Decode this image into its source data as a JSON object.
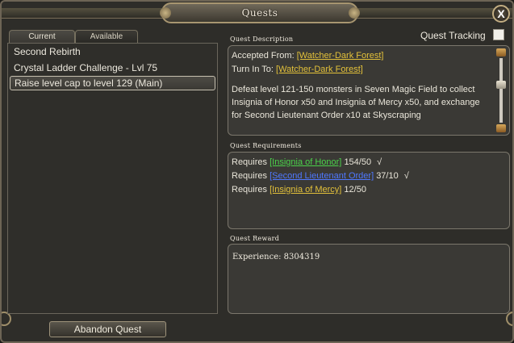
{
  "window": {
    "title": "Quests",
    "close_label": "X"
  },
  "tabs": [
    {
      "label": "Current",
      "active": true
    },
    {
      "label": "Available",
      "active": false
    }
  ],
  "quest_list": [
    {
      "name": "Second Rebirth",
      "selected": false
    },
    {
      "name": "Crystal Ladder Challenge - Lvl 75",
      "selected": false
    },
    {
      "name": "Raise level cap to level 129 (Main)",
      "selected": true
    }
  ],
  "abandon_button": "Abandon Quest",
  "quest_tracking": {
    "label": "Quest Tracking",
    "checked": false
  },
  "description": {
    "header": "Quest Description",
    "accepted_from_label": "Accepted From:",
    "accepted_from_npc": "[Watcher-Dark Forest]",
    "turn_in_label": "Turn In To:",
    "turn_in_npc": "[Watcher-Dark Forest]",
    "body": "Defeat level 121-150 monsters in Seven Magic Field to collect Insignia of Honor x50 and Insignia of Mercy x50, and exchange for Second Lieutenant Order x10 at Skyscraping"
  },
  "requirements": {
    "header": "Quest Requirements",
    "items": [
      {
        "prefix": "Requires",
        "item": "[Insignia of Honor]",
        "progress": "154/50",
        "done": true,
        "mark": "√",
        "color": "#4bd24a"
      },
      {
        "prefix": "Requires",
        "item": "[Second Lieutenant Order]",
        "progress": "37/10",
        "done": true,
        "mark": "√",
        "color": "#4f78ff"
      },
      {
        "prefix": "Requires",
        "item": "[Insignia of Mercy]",
        "progress": "12/50",
        "done": false,
        "mark": "",
        "color": "#e3c13a"
      }
    ]
  },
  "reward": {
    "header": "Quest Reward",
    "experience_label": "Experience:",
    "experience_value": "8304319"
  },
  "colors": {
    "link_gold": "#e3c13a",
    "link_green": "#4bd24a",
    "link_blue": "#4f78ff",
    "frame_gold": "#a89670"
  }
}
